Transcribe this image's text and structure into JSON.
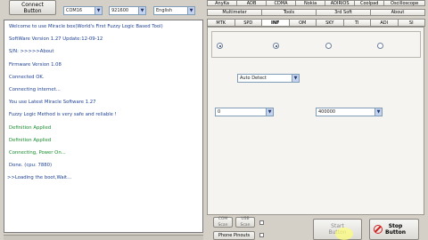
{
  "toolbar": {
    "connect_button": "Connect\nButton",
    "port": "COM16",
    "baud": "921600",
    "language": "English"
  },
  "log": {
    "lines": [
      {
        "text": "Welcome to use Miracle box(World's First Fuzzy Logic Based Tool)"
      },
      {
        "text": "SoftWare Version 1.27  Update:12-09-12"
      },
      {
        "text": "S/N: >>>>>About"
      },
      {
        "text": "Firmware Version 1.08"
      },
      {
        "text": "Connected OK."
      },
      {
        "text": "Connecting internet..."
      },
      {
        "text": "You use Latest Miracle Software 1.27"
      },
      {
        "text": "Fuzzy Logic Method is very safe and reliable !"
      },
      {
        "text": "Definition Applied"
      },
      {
        "text": "Definition Applied"
      },
      {
        "text": "Connecting, Power On..."
      },
      {
        "text": "Done.  (cpu: 7880)"
      },
      {
        "text": ">>Loading the boot,Wait..."
      }
    ]
  },
  "tabs": {
    "row1": [
      "AnyKa",
      "ADB",
      "CDMA",
      "Nokia",
      "ADIRIOS",
      "Coolpad",
      "Oscilloscope"
    ],
    "row2": [
      "Multimeter",
      "Tools",
      "3rd Soft",
      "About"
    ],
    "row3": [
      "MTK",
      "SPD",
      "INF",
      "OM",
      "SKY",
      "TI",
      "ADI",
      "SI"
    ],
    "active_row3": "INF"
  },
  "options": {
    "detect": "Auto Detect",
    "left_value": "0",
    "right_value": "400000"
  },
  "bottom": {
    "com_scan": "COM\nScan",
    "usb_scan": "USB\nScan",
    "phone_pinouts": "Phone Pinouts",
    "start_button": "Start\nButton",
    "stop_button": "Stop\nButton"
  }
}
